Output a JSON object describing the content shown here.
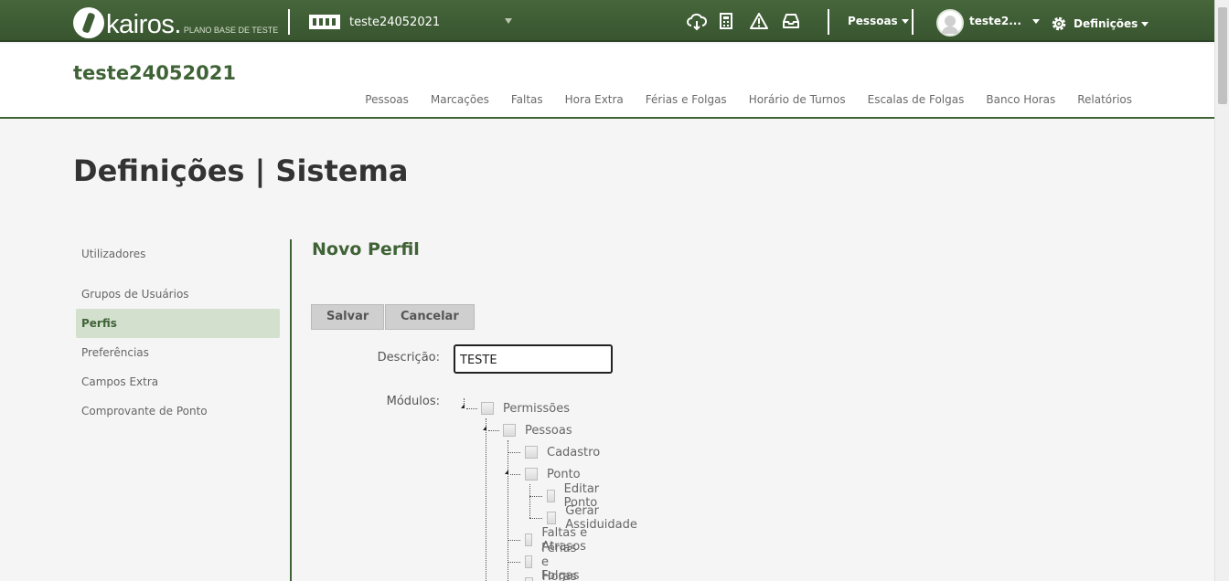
{
  "topbar": {
    "logo_text": "kairos.",
    "logo_sub": "PLANO BASE DE TESTE",
    "company_select": "teste24052021",
    "icons": [
      "cloud-download-icon",
      "calculator-icon",
      "warning-icon",
      "inbox-icon"
    ],
    "pessoas_menu": "Pessoas",
    "user_name": "teste2...",
    "settings_menu": "Definições"
  },
  "header": {
    "company_title": "teste24052021",
    "nav": [
      "Pessoas",
      "Marcações",
      "Faltas",
      "Hora Extra",
      "Férias e Folgas",
      "Horário de Turnos",
      "Escalas de Folgas",
      "Banco Horas",
      "Relatórios"
    ]
  },
  "page": {
    "title": "Definições | Sistema"
  },
  "sidebar": {
    "items": [
      {
        "label": "Utilizadores",
        "active": false
      },
      {
        "label": "Grupos de Usuários",
        "active": false
      },
      {
        "label": "Perfis",
        "active": true
      },
      {
        "label": "Preferências",
        "active": false
      },
      {
        "label": "Campos Extra",
        "active": false
      },
      {
        "label": "Comprovante de Ponto",
        "active": false
      }
    ]
  },
  "form": {
    "title": "Novo Perfil",
    "save_label": "Salvar",
    "cancel_label": "Cancelar",
    "description_label": "Descrição:",
    "description_value": "TESTE",
    "modules_label": "Módulos:",
    "tree": [
      {
        "label": "Permissões",
        "level": 0,
        "expanded": true
      },
      {
        "label": "Pessoas",
        "level": 1,
        "expanded": true
      },
      {
        "label": "Cadastro",
        "level": 2
      },
      {
        "label": "Ponto",
        "level": 2,
        "expanded": true
      },
      {
        "label": "Editar Ponto",
        "level": 3
      },
      {
        "label": "Gerar Assiduidade",
        "level": 3
      },
      {
        "label": "Faltas e Atrasos",
        "level": 2
      },
      {
        "label": "Férias e Folgas",
        "level": 2
      },
      {
        "label": "Horas Extra",
        "level": 2
      }
    ]
  }
}
